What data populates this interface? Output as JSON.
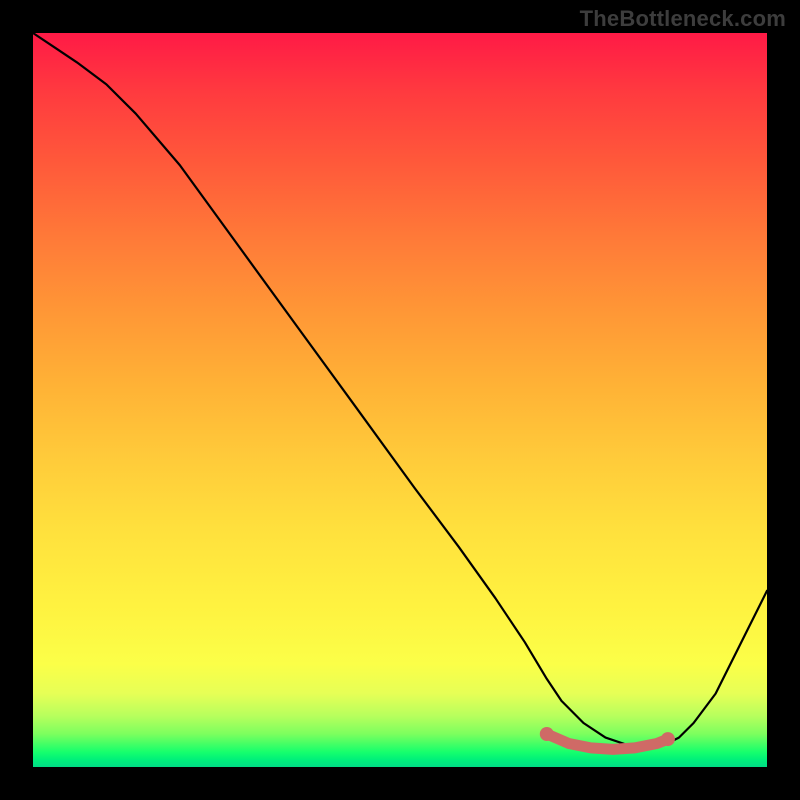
{
  "watermark": "TheBottleneck.com",
  "colors": {
    "frame": "#000000",
    "curve": "#000000",
    "marker": "#cf6a66"
  },
  "chart_data": {
    "type": "line",
    "title": "",
    "xlabel": "",
    "ylabel": "",
    "xlim": [
      0,
      100
    ],
    "ylim": [
      0,
      100
    ],
    "grid": false,
    "series": [
      {
        "name": "bottleneck-curve",
        "x": [
          0,
          3,
          6,
          10,
          14,
          20,
          28,
          36,
          44,
          52,
          58,
          63,
          67,
          70,
          72,
          75,
          78,
          81,
          84,
          86,
          88,
          90,
          93,
          96,
          100
        ],
        "y": [
          100,
          98,
          96,
          93,
          89,
          82,
          71,
          60,
          49,
          38,
          30,
          23,
          17,
          12,
          9,
          6,
          4,
          3,
          2.5,
          3,
          4,
          6,
          10,
          16,
          24
        ]
      }
    ],
    "markers": {
      "name": "optimal-range",
      "x": [
        70,
        73,
        76,
        79,
        82,
        85,
        86.5
      ],
      "y": [
        4.5,
        3.2,
        2.6,
        2.4,
        2.6,
        3.2,
        3.8
      ]
    },
    "background_gradient": {
      "top": "#ff1a46",
      "middle": "#ffe13d",
      "bottom": "#00dc85"
    }
  }
}
